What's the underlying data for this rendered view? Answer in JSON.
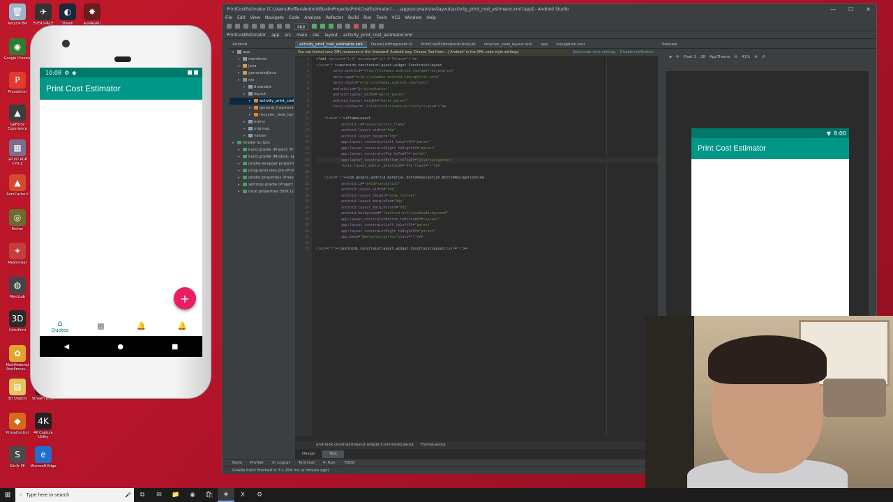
{
  "desktop": {
    "icons": [
      {
        "label": "Recycle Bin",
        "color": "#9fb6c8",
        "glyph": "🗑"
      },
      {
        "label": "Google Chrome",
        "color": "#2e7d32",
        "glyph": "◉"
      },
      {
        "label": "Prusaslicer",
        "color": "#e33b2e",
        "glyph": "P"
      },
      {
        "label": "GeForce Experience",
        "color": "#3d3d3d",
        "glyph": "▲"
      },
      {
        "label": "GPU/D RGB CPU-Z",
        "color": "#7b6e8c",
        "glyph": "▦"
      },
      {
        "label": "RamCache II",
        "color": "#d34a2e",
        "glyph": "▲"
      },
      {
        "label": "Etcher",
        "color": "#6b6b2e",
        "glyph": "◎"
      },
      {
        "label": "Meshmixer",
        "color": "#c73c3c",
        "glyph": "✦"
      },
      {
        "label": "MeshLab",
        "color": "#444",
        "glyph": "◍"
      },
      {
        "label": "ColorPrint",
        "color": "#2a2a2a",
        "glyph": "3D"
      },
      {
        "label": "MultiMaterial PostProces...",
        "color": "#e0a52d",
        "glyph": "✿"
      },
      {
        "label": "3D Objects",
        "color": "#e7c45e",
        "glyph": "▤"
      },
      {
        "label": "PrusaControl",
        "color": "#d56a1c",
        "glyph": "◆"
      },
      {
        "label": "Slic3r PE",
        "color": "#4a4a4a",
        "glyph": "S"
      },
      {
        "label": "EVERSPACE",
        "color": "#333",
        "glyph": "✈"
      },
      {
        "label": "Steam",
        "color": "#1b2838",
        "glyph": "◐"
      },
      {
        "label": "AURAGRU",
        "color": "#6b1c1c",
        "glyph": "✸"
      },
      {
        "label": "Stream Deck",
        "color": "#222",
        "glyph": "▦"
      },
      {
        "label": "4K Capture Utility",
        "color": "#222",
        "glyph": "4K"
      },
      {
        "label": "Microsoft Edge",
        "color": "#1e6fcf",
        "glyph": "e"
      }
    ]
  },
  "emulator": {
    "status_time": "10:08",
    "app_title": "Print Cost Estimator",
    "fab_icon": "+",
    "nav": [
      {
        "label": "Quotes",
        "icon": "⌂",
        "active": true
      },
      {
        "label": "",
        "icon": "▦",
        "active": false
      },
      {
        "label": "",
        "icon": "🔔",
        "active": false
      },
      {
        "label": "",
        "icon": "🔔",
        "active": false
      }
    ],
    "sysnav": [
      "◀",
      "●",
      "■"
    ]
  },
  "ide": {
    "title": "PrintCostEstimator [C:\\Users\\Ruffles\\AndroidStudioProjects\\PrintCostEstimator] - ...\\app\\src\\main\\res\\layout\\activity_print_cost_estimator.xml [app] - Android Studio",
    "menu": [
      "File",
      "Edit",
      "View",
      "Navigate",
      "Code",
      "Analyze",
      "Refactor",
      "Build",
      "Run",
      "Tools",
      "VCS",
      "Window",
      "Help"
    ],
    "run_config": "app",
    "breadcrumb": [
      "PrintCostEstimator",
      "app",
      "src",
      "main",
      "res",
      "layout",
      "activity_print_cost_estimator.xml"
    ],
    "project_header": "Android",
    "tree": [
      {
        "label": "app",
        "indent": 0,
        "kind": "app",
        "sel": false
      },
      {
        "label": "manifests",
        "indent": 1,
        "kind": "dir",
        "sel": false
      },
      {
        "label": "java",
        "indent": 1,
        "kind": "java",
        "sel": false
      },
      {
        "label": "generatedJava",
        "indent": 1,
        "kind": "java",
        "sel": false
      },
      {
        "label": "res",
        "indent": 1,
        "kind": "res",
        "sel": false
      },
      {
        "label": "drawable",
        "indent": 2,
        "kind": "dir",
        "sel": false
      },
      {
        "label": "layout",
        "indent": 2,
        "kind": "dir",
        "sel": false
      },
      {
        "label": "activity_print_cost_estimator.xml",
        "indent": 3,
        "kind": "xml",
        "sel": true
      },
      {
        "label": "general_fragment.xml",
        "indent": 3,
        "kind": "xml",
        "sel": false
      },
      {
        "label": "recycler_view_layout.xml",
        "indent": 3,
        "kind": "xml",
        "sel": false
      },
      {
        "label": "menu",
        "indent": 2,
        "kind": "dir",
        "sel": false
      },
      {
        "label": "mipmap",
        "indent": 2,
        "kind": "dir",
        "sel": false
      },
      {
        "label": "values",
        "indent": 2,
        "kind": "dir",
        "sel": false
      },
      {
        "label": "Gradle Scripts",
        "indent": 0,
        "kind": "grad",
        "sel": false
      },
      {
        "label": "build.gradle (Project: PrintCostEstimator)",
        "indent": 1,
        "kind": "grad",
        "sel": false
      },
      {
        "label": "build.gradle (Module: app)",
        "indent": 1,
        "kind": "grad",
        "sel": false
      },
      {
        "label": "gradle-wrapper.properties (Gradle Version)",
        "indent": 1,
        "kind": "grad",
        "sel": false
      },
      {
        "label": "proguard-rules.pro (ProGuard Rules for app)",
        "indent": 1,
        "kind": "grad",
        "sel": false
      },
      {
        "label": "gradle.properties (Project Properties)",
        "indent": 1,
        "kind": "grad",
        "sel": false
      },
      {
        "label": "settings.gradle (Project Settings)",
        "indent": 1,
        "kind": "grad",
        "sel": false
      },
      {
        "label": "local.properties (SDK Location)",
        "indent": 1,
        "kind": "grad",
        "sel": false
      }
    ],
    "tabs": [
      {
        "label": "activity_print_cost_estimator.xml",
        "active": true
      },
      {
        "label": "QuoteListFragment.kt",
        "active": false
      },
      {
        "label": "PrintCostEstimatorActivity.kt",
        "active": false
      },
      {
        "label": "recycler_view_layout.xml",
        "active": false
      },
      {
        "label": "app",
        "active": false
      },
      {
        "label": "navigation.xml",
        "active": false
      }
    ],
    "notice": "You can format your XML resources in the 'standard' Android way. Choose 'Set from... | Android' in the XML code style settings.",
    "notice_links": [
      "Open code style settings",
      "Disable notification"
    ],
    "code_lines": [
      "<?xml version=\"1.0\" encoding=\"utf-8\"?>",
      "<androidx.constraintlayout.widget.ConstraintLayout",
      "        xmlns:android=\"http://schemas.android.com/apk/res/android\"",
      "        xmlns:app=\"http://schemas.android.com/apk/res-auto\"",
      "        xmlns:tools=\"http://schemas.android.com/tools\"",
      "        android:id=\"@+id/container\"",
      "        android:layout_width=\"match_parent\"",
      "        android:layout_height=\"match_parent\"",
      "        tools:context=\".PrintCostEstimatorActivity\">",
      "",
      "    <FrameLayout",
      "            android:id=\"@+id/content_frame\"",
      "            android:layout_width=\"0dp\"",
      "            android:layout_height=\"0dp\"",
      "            app:layout_constraintLeft_toLeftOf=\"parent\"",
      "            app:layout_constraintRight_toRightOf=\"parent\"",
      "            app:layout_constraintTop_toTopOf=\"parent\"",
      "            app:layout_constraintBottom_toTopOf=\"@+id/navigation\"",
      "            tools:layout_editor_absoluteX=\"0dp\"/>",
      "",
      "    <com.google.android.material.bottomnavigation.BottomNavigationView",
      "            android:id=\"@+id/navigation\"",
      "            android:layout_width=\"0dp\"",
      "            android:layout_height=\"wrap_content\"",
      "            android:layout_marginEnd=\"0dp\"",
      "            android:layout_marginStart=\"0dp\"",
      "            android:background=\"?android:attr/windowBackground\"",
      "            app:layout_constraintBottom_toBottomOf=\"parent\"",
      "            app:layout_constraintLeft_toLeftOf=\"parent\"",
      "            app:layout_constraintRight_toRightOf=\"parent\"",
      "            app:menu=\"@menu/navigation\"/>",
      "",
      "</androidx.constraintlayout.widget.ConstraintLayout>"
    ],
    "highlight_line": 17,
    "editor_breadcrumb": [
      "androidx.constraintlayout.widget.ConstraintLayout",
      "FrameLayout"
    ],
    "design_tabs": [
      {
        "label": "Design",
        "active": false
      },
      {
        "label": "Text",
        "active": true
      }
    ],
    "preview": {
      "header": "Preview",
      "device": "Pixel 2",
      "api": "28",
      "theme": "AppTheme",
      "zoom": "41%",
      "status_time": "8:00",
      "app_title": "Print Cost Estimator"
    },
    "bottom_tools": [
      "Build",
      "Profiler",
      "6: Logcat",
      "Terminal",
      "4: Run",
      "TODO"
    ],
    "status": "Gradle build finished in 3 s 254 ms (a minute ago)"
  },
  "taskbar": {
    "search_placeholder": "Type here to search",
    "apps": [
      "⧉",
      "✉",
      "📁",
      "◉",
      "🛍",
      "◈",
      "X",
      "⚙"
    ]
  }
}
